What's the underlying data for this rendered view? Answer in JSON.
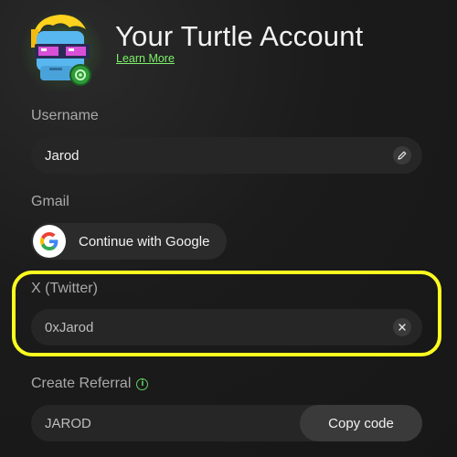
{
  "header": {
    "title": "Your Turtle Account",
    "learn_more": "Learn More"
  },
  "username": {
    "label": "Username",
    "value": "Jarod",
    "edit_icon": "pencil-icon"
  },
  "gmail": {
    "label": "Gmail",
    "button_label": "Continue with Google",
    "icon": "google-logo-icon"
  },
  "twitter": {
    "label": "X (Twitter)",
    "value": "0xJarod",
    "clear_icon": "close-icon"
  },
  "referral": {
    "label": "Create Referral",
    "info_icon": "info-icon",
    "value": "JAROD",
    "copy_label": "Copy code"
  },
  "colors": {
    "accent_green": "#7cf26a",
    "highlight_yellow": "#ffff1f",
    "background": "#1b1b1b",
    "field_bg": "#262626"
  }
}
